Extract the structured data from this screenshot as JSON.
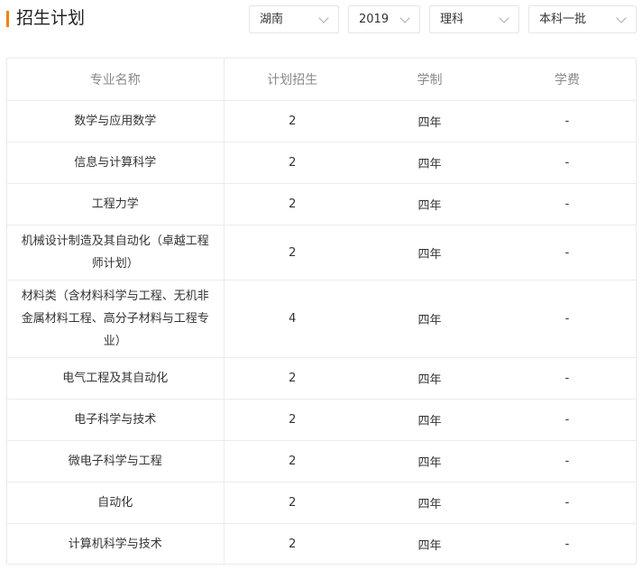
{
  "header": {
    "title": "招生计划",
    "filters": {
      "province": "湖南",
      "year": "2019",
      "category": "理科",
      "batch": "本科一批"
    }
  },
  "table": {
    "columns": [
      "专业名称",
      "计划招生",
      "学制",
      "学费"
    ],
    "rows": [
      {
        "name": "数学与应用数学",
        "plan": "2",
        "duration": "四年",
        "fee": "-"
      },
      {
        "name": "信息与计算科学",
        "plan": "2",
        "duration": "四年",
        "fee": "-"
      },
      {
        "name": "工程力学",
        "plan": "2",
        "duration": "四年",
        "fee": "-"
      },
      {
        "name": "机械设计制造及其自动化（卓越工程师计划）",
        "plan": "2",
        "duration": "四年",
        "fee": "-"
      },
      {
        "name": "材料类（含材料科学与工程、无机非金属材料工程、高分子材料与工程专业）",
        "plan": "4",
        "duration": "四年",
        "fee": "-"
      },
      {
        "name": "电气工程及其自动化",
        "plan": "2",
        "duration": "四年",
        "fee": "-"
      },
      {
        "name": "电子科学与技术",
        "plan": "2",
        "duration": "四年",
        "fee": "-"
      },
      {
        "name": "微电子科学与工程",
        "plan": "2",
        "duration": "四年",
        "fee": "-"
      },
      {
        "name": "自动化",
        "plan": "2",
        "duration": "四年",
        "fee": "-"
      },
      {
        "name": "计算机科学与技术",
        "plan": "2",
        "duration": "四年",
        "fee": "-"
      }
    ]
  },
  "colors": {
    "accent": "#f08300",
    "border": "#ececec",
    "header_text": "#8a8a8a"
  }
}
